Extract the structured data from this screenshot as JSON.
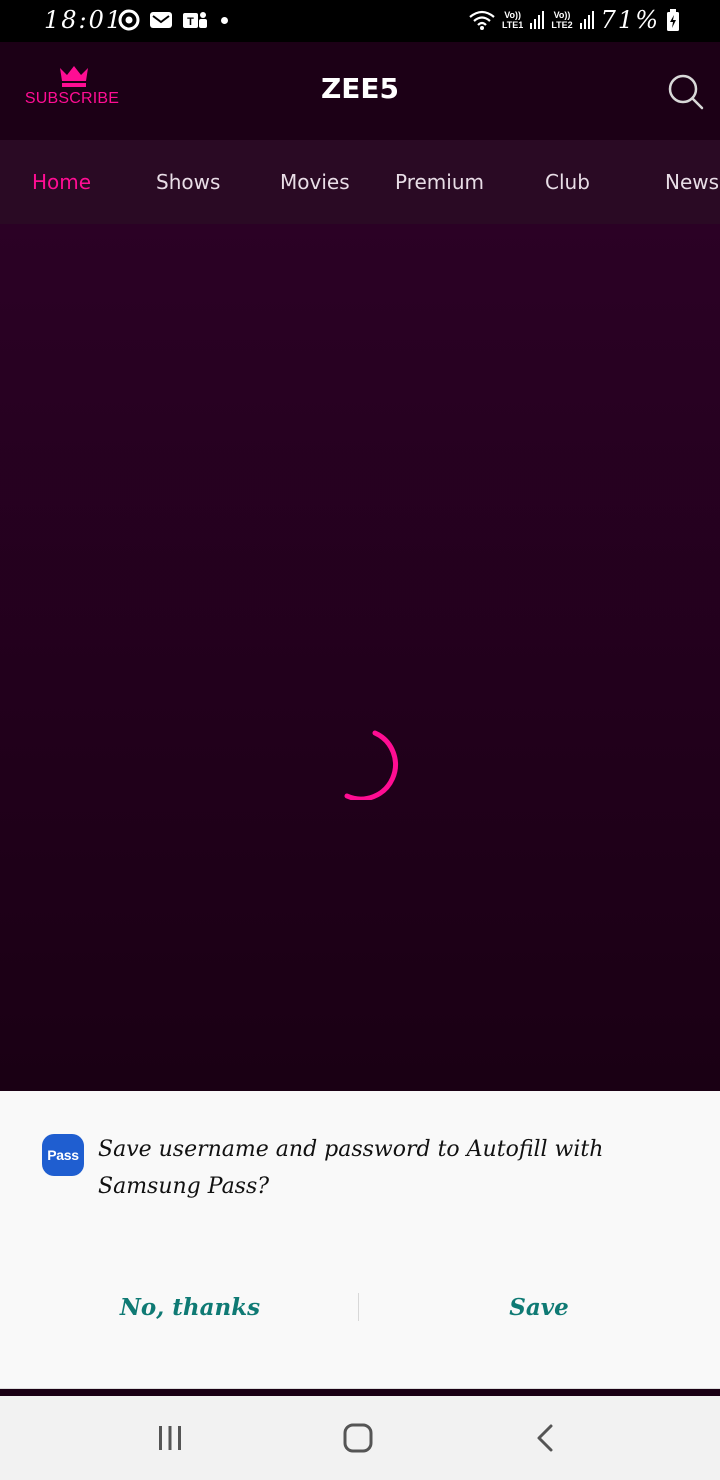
{
  "status_bar": {
    "time": "18:01",
    "battery_percent": "71%",
    "sim1_label": "LTE1",
    "sim2_label": "LTE2",
    "volte_label": "Vo))"
  },
  "header": {
    "subscribe_label": "SUBSCRIBE",
    "app_title": "ZEE5"
  },
  "tabs": [
    {
      "label": "Home",
      "active": true
    },
    {
      "label": "Shows"
    },
    {
      "label": "Movies"
    },
    {
      "label": "Premium"
    },
    {
      "label": "Club"
    },
    {
      "label": "News"
    }
  ],
  "colors": {
    "accent": "#ff0d93",
    "header_bg": "#1c0016",
    "tabs_bg": "#2a0a24",
    "content_bg": "#22011d",
    "pass_blue": "#1f5ed0",
    "pass_button_text": "#0f7a74"
  },
  "pass_dialog": {
    "logo_text": "Pass",
    "message": "Save username and password to Autofill with Samsung Pass?",
    "no_label": "No, thanks",
    "save_label": "Save"
  },
  "icons": {
    "subscribe": "crown-icon",
    "search": "search-icon",
    "loading": "spinner-icon",
    "recents": "recents-icon",
    "home": "home-icon",
    "back": "back-icon"
  }
}
